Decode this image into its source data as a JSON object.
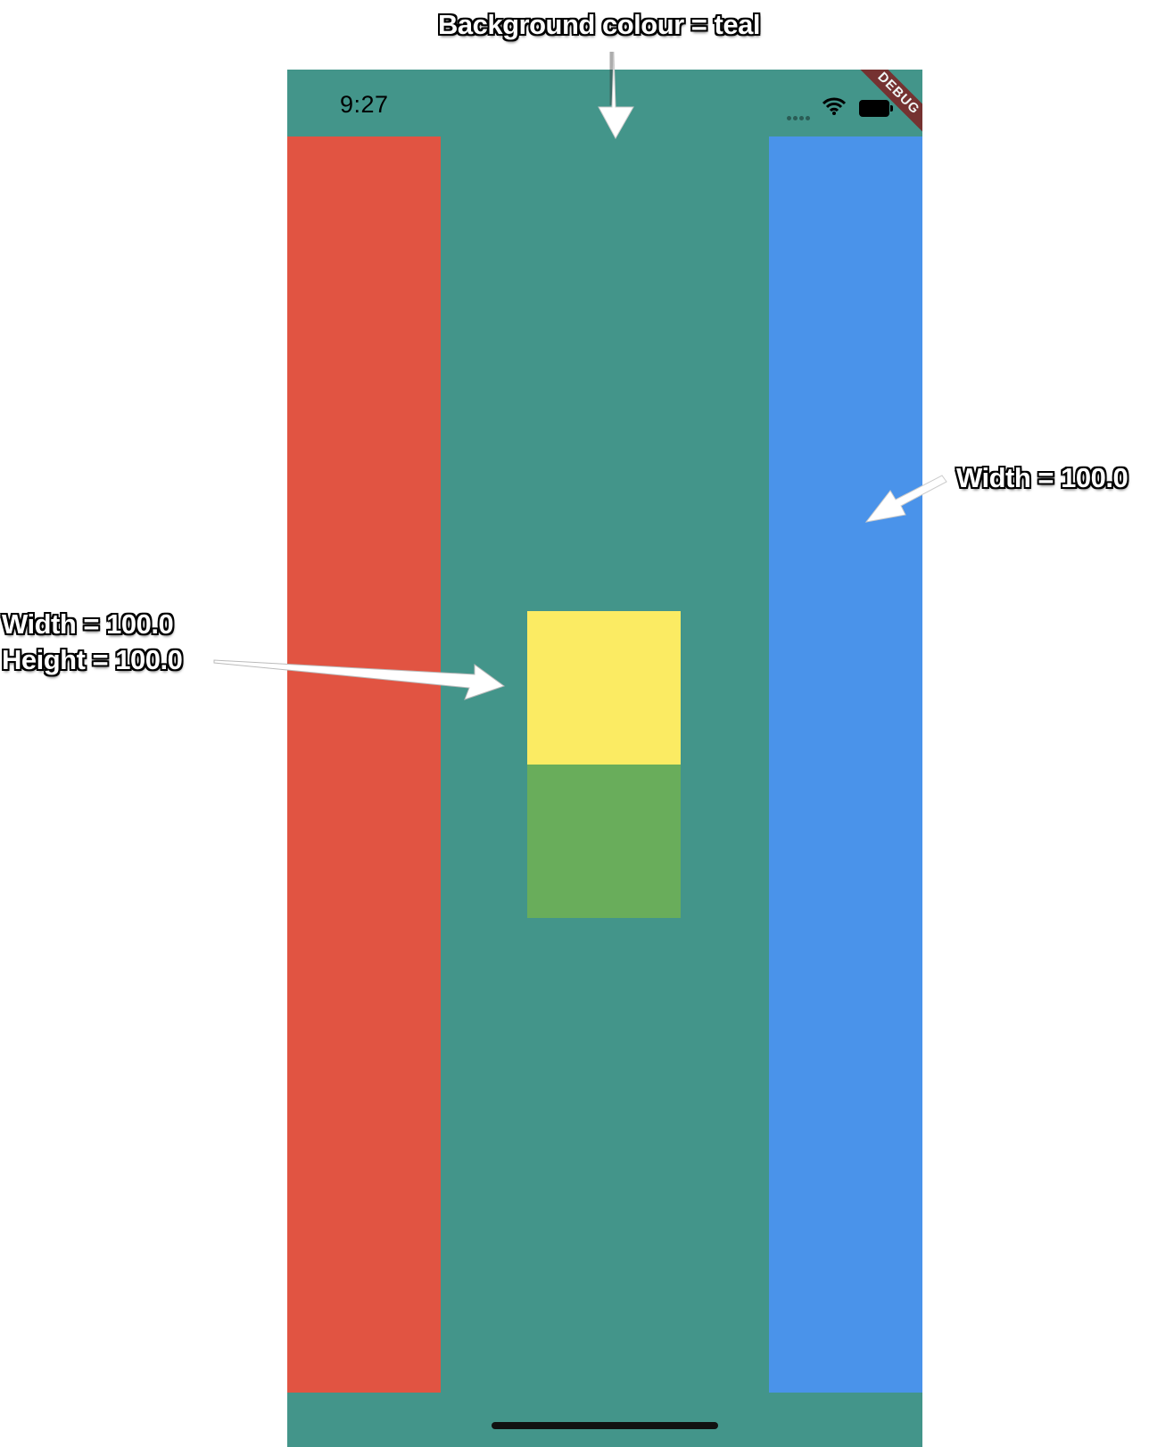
{
  "annotations": {
    "background": "Background colour = teal",
    "right_width": "Width = 100.0",
    "left_width": "Width = 100.0",
    "left_height": "Height = 100.0"
  },
  "status_bar": {
    "time": "9:27",
    "icons": [
      "signal-dots-icon",
      "wifi-icon",
      "battery-icon"
    ]
  },
  "debug_banner": "DEBUG",
  "colors": {
    "background_teal": "#43958a",
    "red": "#e15442",
    "blue": "#4a93ea",
    "yellow": "#fbeb63",
    "green": "#69ad5b"
  }
}
